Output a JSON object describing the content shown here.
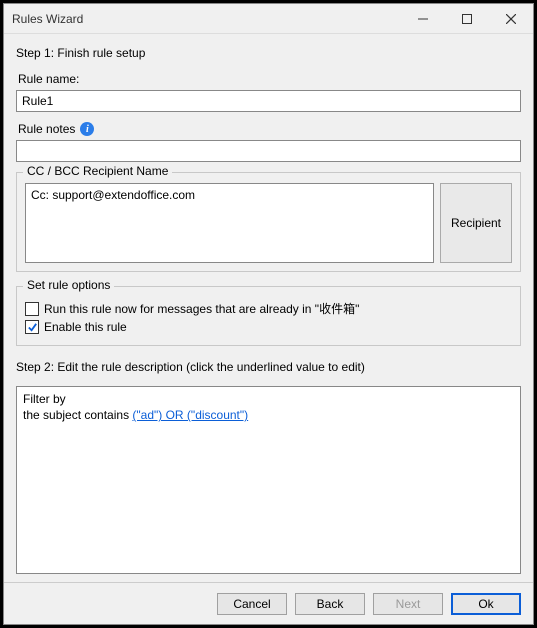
{
  "window": {
    "title": "Rules Wizard"
  },
  "step1": {
    "heading": "Step 1: Finish rule setup",
    "ruleNameLabel": "Rule name:",
    "ruleNameValue": "Rule1",
    "ruleNotesLabel": "Rule notes",
    "ruleNotesValue": ""
  },
  "ccGroup": {
    "legend": "CC / BCC Recipient Name",
    "value": "Cc: support@extendoffice.com",
    "recipientBtn": "Recipient"
  },
  "optionsGroup": {
    "legend": "Set rule options",
    "runNow": {
      "label": "Run this rule now for messages that are already in \"收件箱\"",
      "checked": false
    },
    "enable": {
      "label": "Enable this rule",
      "checked": true
    }
  },
  "step2": {
    "heading": "Step 2: Edit the rule description (click the underlined value to edit)",
    "line1": "Filter by",
    "line2Prefix": "the subject contains ",
    "line2Link": "(\"ad\") OR (\"discount\")"
  },
  "buttons": {
    "cancel": "Cancel",
    "back": "Back",
    "next": "Next",
    "ok": "Ok"
  }
}
